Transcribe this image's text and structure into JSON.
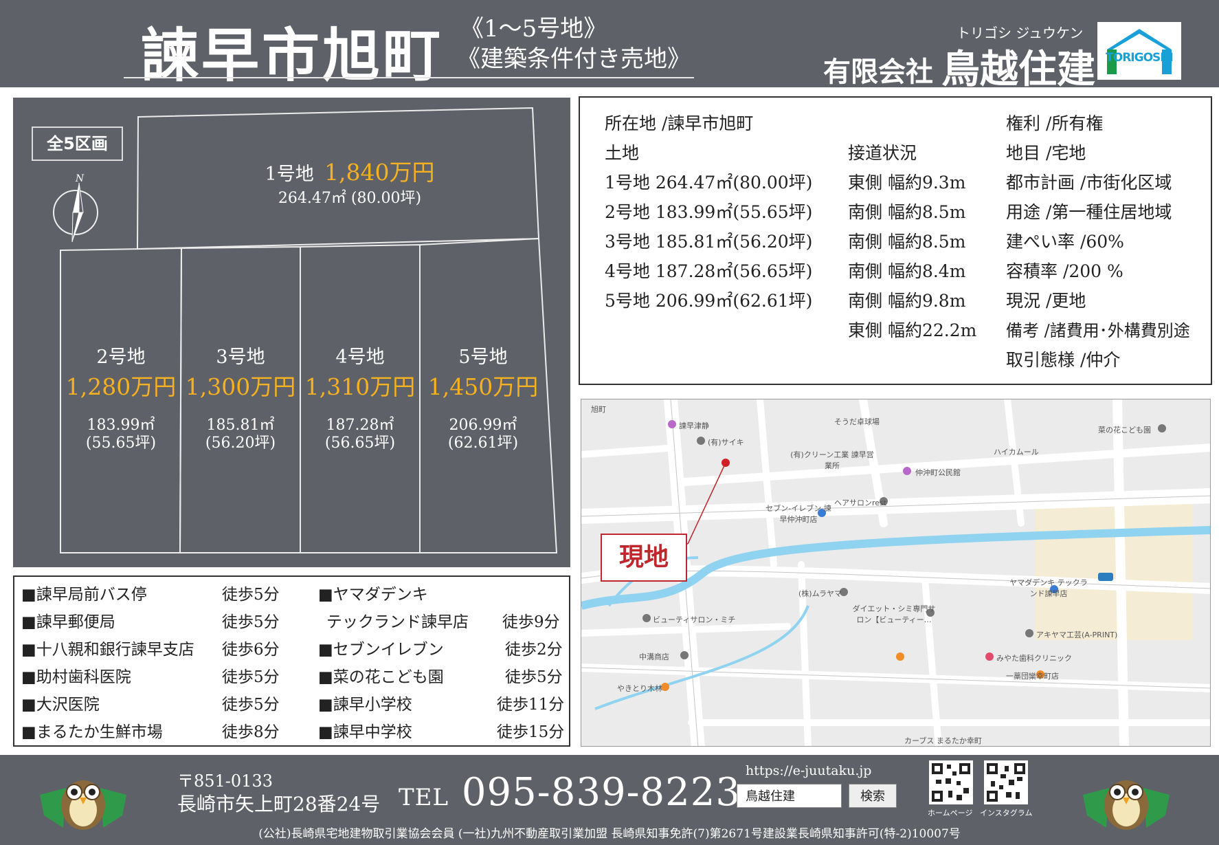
{
  "header": {
    "title": "諫早市旭町",
    "subtitle_lots": "《1～5号地》",
    "subtitle_type": "《建築条件付き売地》",
    "company_kana": "トリゴシ ジュウケン",
    "company_prefix": "有限会社",
    "company_name": "鳥越住建",
    "logo_text": "TORIGOSHI"
  },
  "plot": {
    "total_badge": "全5区画",
    "compass_label": "N",
    "lots": [
      {
        "name": "1号地",
        "price": "1,840万円",
        "area_m2": "264.47㎡",
        "area_tsubo": "(80.00坪)"
      },
      {
        "name": "2号地",
        "price": "1,280万円",
        "area_m2": "183.99㎡",
        "area_tsubo": "(55.65坪)"
      },
      {
        "name": "3号地",
        "price": "1,300万円",
        "area_m2": "185.81㎡",
        "area_tsubo": "(56.20坪)"
      },
      {
        "name": "4号地",
        "price": "1,310万円",
        "area_m2": "187.28㎡",
        "area_tsubo": "(56.65坪)"
      },
      {
        "name": "5号地",
        "price": "1,450万円",
        "area_m2": "206.99㎡",
        "area_tsubo": "(62.61坪)"
      }
    ]
  },
  "info": {
    "location": "所在地 /諫早市旭町",
    "land_heading": "土地",
    "lots": [
      "1号地 264.47㎡(80.00坪)",
      "2号地 183.99㎡(55.65坪)",
      "3号地 185.81㎡(56.20坪)",
      "4号地 187.28㎡(56.65坪)",
      "5号地 206.99㎡(62.61坪)"
    ],
    "road_heading": "接道状況",
    "roads": [
      "東側 幅約9.3m",
      "南側 幅約8.5m",
      "南側 幅約8.5m",
      "南側 幅約8.4m",
      "南側 幅約9.8m",
      "東側 幅約22.2m"
    ],
    "specs": [
      "権利 /所有権",
      "地目 /宅地",
      "都市計画 /市街化区域",
      "用途 /第一種住居地域",
      "建ぺい率 /60%",
      "容積率 /200 %",
      "現況 /更地",
      "備考 /諸費用･外構費別途",
      "取引態様 /仲介"
    ]
  },
  "map": {
    "site_label": "現地",
    "labels": [
      "旭町",
      "諫早津静",
      "(有)サイキ",
      "そうだ卓球場",
      "菜の花こども園",
      "(有)クリーン工業 諫早営業所",
      "ハイカムール",
      "仲沖町公民館",
      "ヘアサロンrest",
      "セブン-イレブン 諫早仲沖町店",
      "(株)ムラヤマ",
      "ダイエット・シミ専門サロン【ビューティー…",
      "ビューティサロン・ミチ",
      "ヤマダデンキ テックランド諫早店",
      "アキヤマ工芸(A-PRINT)",
      "みやた歯科クリニック",
      "一藁団欒幸町店",
      "中溝商店",
      "やきとり木林",
      "カーブス まるたか幸町"
    ]
  },
  "access": {
    "left": [
      {
        "place": "■諫早局前バス停",
        "time": "徒歩5分"
      },
      {
        "place": "■諫早郵便局",
        "time": "徒歩5分"
      },
      {
        "place": "■十八親和銀行諫早支店",
        "time": "徒歩6分"
      },
      {
        "place": "■助村歯科医院",
        "time": "徒歩5分"
      },
      {
        "place": "■大沢医院",
        "time": "徒歩5分"
      },
      {
        "place": "■まるたか生鮮市場",
        "time": "徒歩8分"
      }
    ],
    "right": [
      {
        "place": "■ヤマダデンキ",
        "time": ""
      },
      {
        "place": "テックランド諫早店",
        "time": "徒歩9分"
      },
      {
        "place": "■セブンイレブン",
        "time": "徒歩2分"
      },
      {
        "place": "■菜の花こども園",
        "time": "徒歩5分"
      },
      {
        "place": "■諫早小学校",
        "time": "徒歩11分"
      },
      {
        "place": "■諫早中学校",
        "time": "徒歩15分"
      }
    ]
  },
  "footer": {
    "postal": "〒851-0133",
    "address": "長崎市矢上町28番24号",
    "tel_label": "TEL",
    "tel_number": "095-839-8223",
    "url": "https://e-juutaku.jp",
    "search_value": "鳥越住建",
    "search_button": "検索",
    "qr_home_caption": "ホームページ",
    "qr_insta_caption": "インスタグラム",
    "license": "(公社)長崎県宅地建物取引業協会会員 (一社)九州不動産取引業加盟 長崎県知事免許(7)第2671号建設業長崎県知事許可(特-2)10007号"
  },
  "colors": {
    "panel_gray": "#5f6168",
    "price_orange": "#f5b120",
    "site_red": "#c0272d",
    "road_white": "#ffffff",
    "water_blue": "#8fd3f0"
  }
}
